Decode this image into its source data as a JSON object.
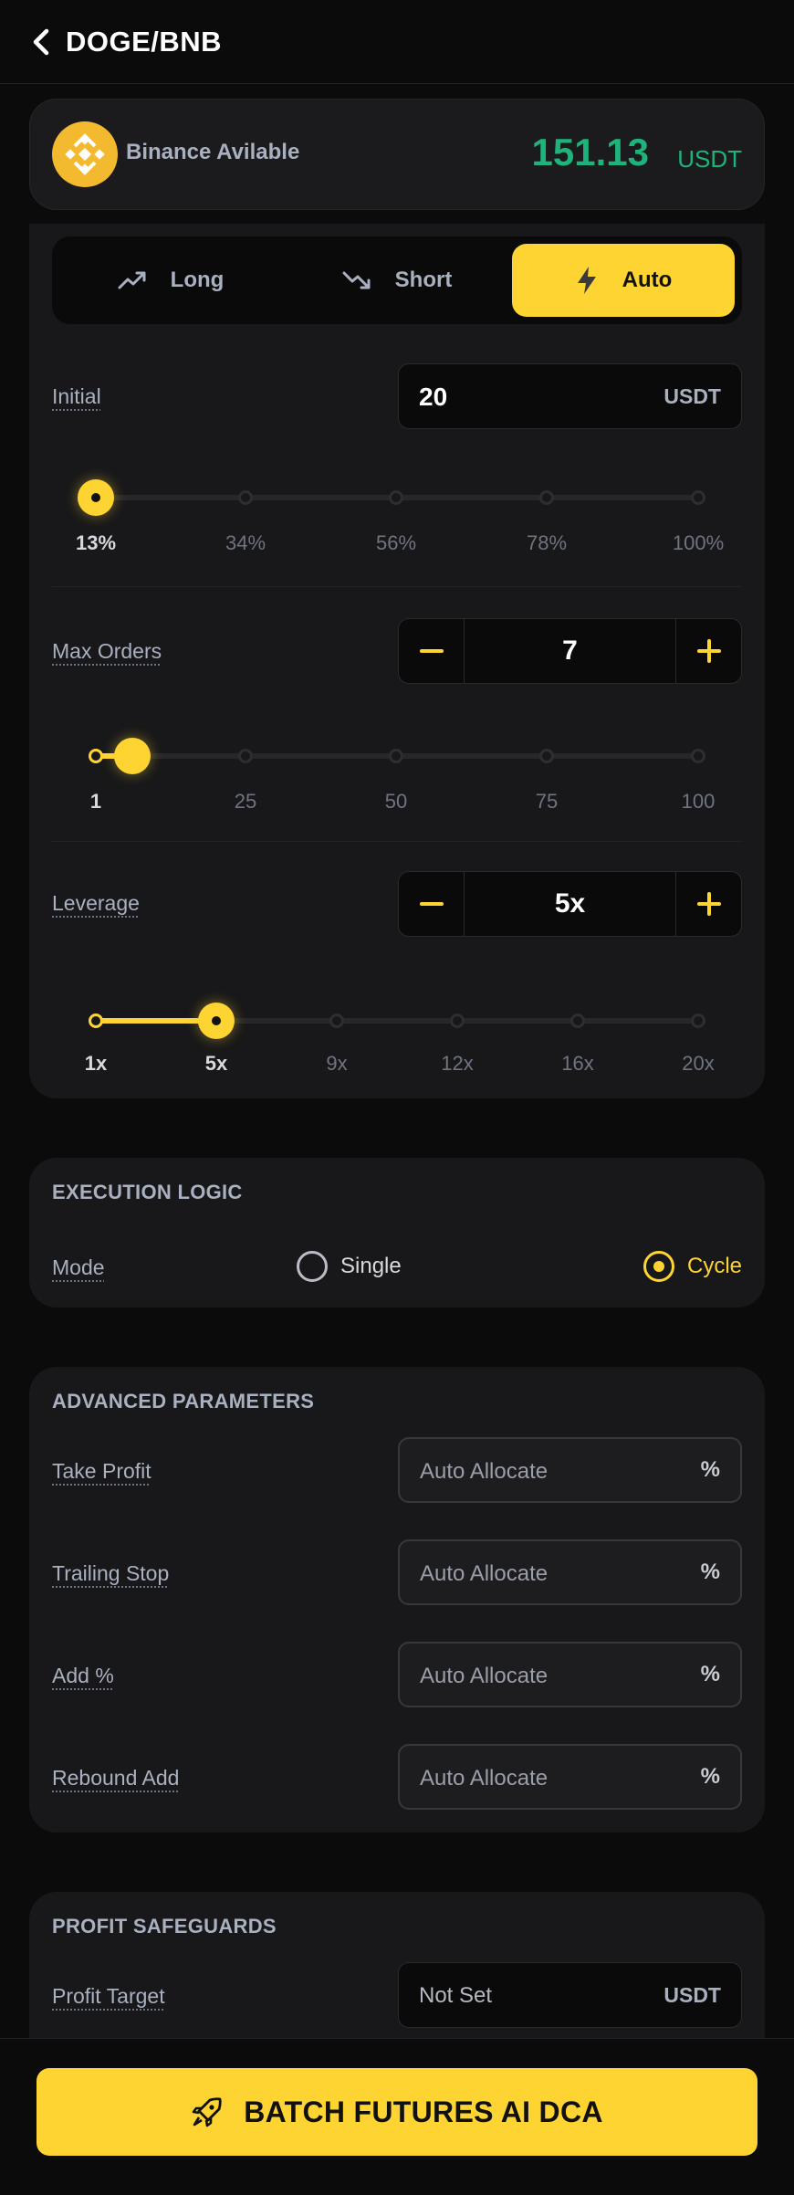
{
  "header": {
    "title": "DOGE/BNB"
  },
  "balance": {
    "label": "Binance Avilable",
    "value": "151.13",
    "unit": "USDT",
    "value_color": "#1fb27a"
  },
  "mode_tabs": [
    {
      "label": "Long",
      "icon": "trend-up-icon",
      "active": false
    },
    {
      "label": "Short",
      "icon": "trend-down-icon",
      "active": false
    },
    {
      "label": "Auto",
      "icon": "lightning-icon",
      "active": true
    }
  ],
  "initial": {
    "label": "Initial",
    "value": "20",
    "unit": "USDT",
    "slider": {
      "ticks": [
        "13%",
        "34%",
        "56%",
        "78%",
        "100%"
      ],
      "selected_index": 0
    }
  },
  "max_orders": {
    "label": "Max Orders",
    "value": "7",
    "slider": {
      "ticks": [
        "1",
        "25",
        "50",
        "75",
        "100"
      ],
      "selected_index": 0,
      "level_fraction": 0.06
    }
  },
  "leverage": {
    "label": "Leverage",
    "value": "5x",
    "slider": {
      "ticks": [
        "1x",
        "5x",
        "9x",
        "12x",
        "16x",
        "20x"
      ],
      "selected_index": 1
    }
  },
  "execution": {
    "title": "EXECUTION LOGIC",
    "mode_label": "Mode",
    "options": [
      {
        "label": "Single",
        "selected": false
      },
      {
        "label": "Cycle",
        "selected": true
      }
    ]
  },
  "advanced": {
    "title": "ADVANCED PARAMETERS",
    "fields": [
      {
        "label": "Take Profit",
        "placeholder": "Auto Allocate",
        "unit": "%"
      },
      {
        "label": "Trailing Stop",
        "placeholder": "Auto Allocate",
        "unit": "%"
      },
      {
        "label": "Add %",
        "placeholder": "Auto Allocate",
        "unit": "%"
      },
      {
        "label": "Rebound Add",
        "placeholder": "Auto Allocate",
        "unit": "%"
      }
    ]
  },
  "safeguards": {
    "title": "PROFIT SAFEGUARDS",
    "fields": [
      {
        "label": "Profit Target",
        "value": "Not Set",
        "unit": "USDT"
      }
    ]
  },
  "cta": {
    "label": "BATCH FUTURES AI DCA",
    "icon": "rocket-icon"
  },
  "colors": {
    "accent": "#fdd432",
    "background": "#0b0b0c",
    "card": "#18181a",
    "positive": "#1fb27a"
  }
}
